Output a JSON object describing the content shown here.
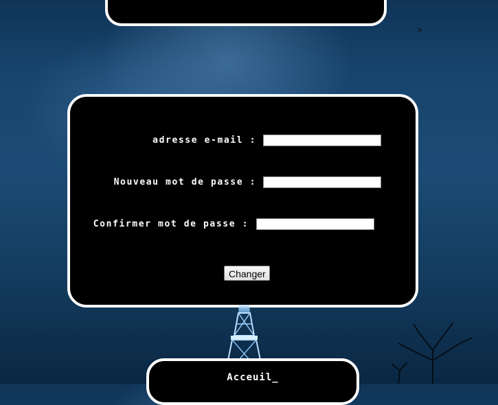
{
  "top_bar": {
    "cursor_glyph": ">"
  },
  "form": {
    "fields": [
      {
        "label": "adresse e-mail :",
        "value": ""
      },
      {
        "label": "Nouveau mot de passe :",
        "value": ""
      },
      {
        "label": "Confirmer mot de passe :",
        "value": ""
      }
    ],
    "submit_label": "Changer"
  },
  "footer": {
    "home_label": "Acceuil_"
  },
  "colors": {
    "panel_background": "#000000",
    "panel_border": "#ffffff",
    "page_background": "#17446d"
  }
}
